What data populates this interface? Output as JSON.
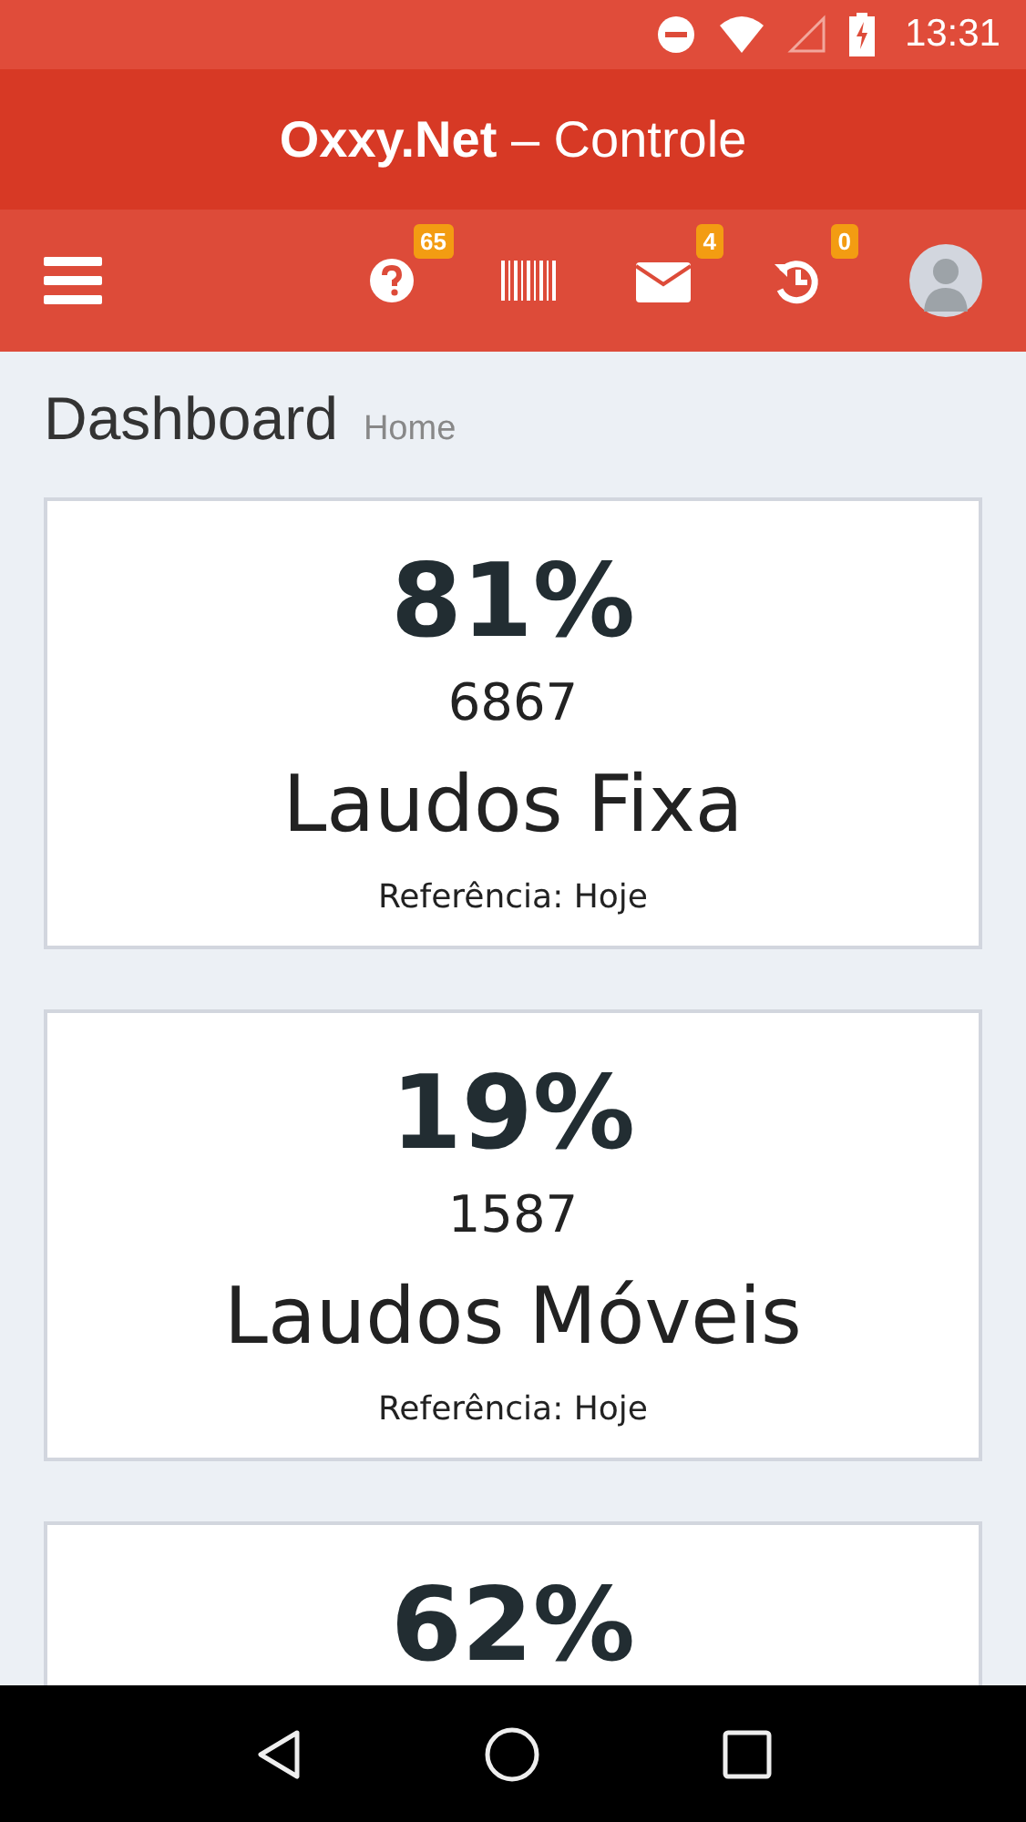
{
  "status_bar": {
    "time": "13:31"
  },
  "app_bar": {
    "title": "**Oxxy.Net** – Controle"
  },
  "toolbar": {
    "items": [
      {
        "kind": "help",
        "badge": "65"
      },
      {
        "kind": "barcode"
      },
      {
        "kind": "mail",
        "badge": "4"
      },
      {
        "kind": "history",
        "badge": "0"
      }
    ]
  },
  "page": {
    "title": "Dashboard",
    "breadcrumb": "Home"
  },
  "cards": [
    {
      "percent": "81%",
      "count": "6867",
      "label": "Laudos Fixa",
      "reference": "Referência: Hoje"
    },
    {
      "percent": "19%",
      "count": "1587",
      "label": "Laudos Móveis",
      "reference": "Referência: Hoje"
    },
    {
      "percent": "62%"
    }
  ]
}
